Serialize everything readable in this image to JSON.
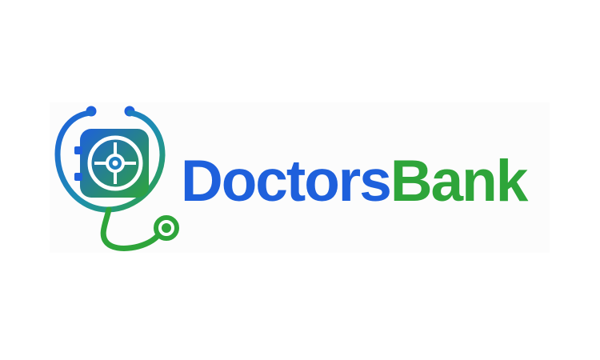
{
  "logo": {
    "name_part_1": "Doctors",
    "name_part_2": "Bank",
    "emblem_icon": "stethoscope-vault-icon"
  },
  "colors": {
    "blue": "#1e60dc",
    "green": "#2ea53a",
    "background": "#ffffff"
  }
}
